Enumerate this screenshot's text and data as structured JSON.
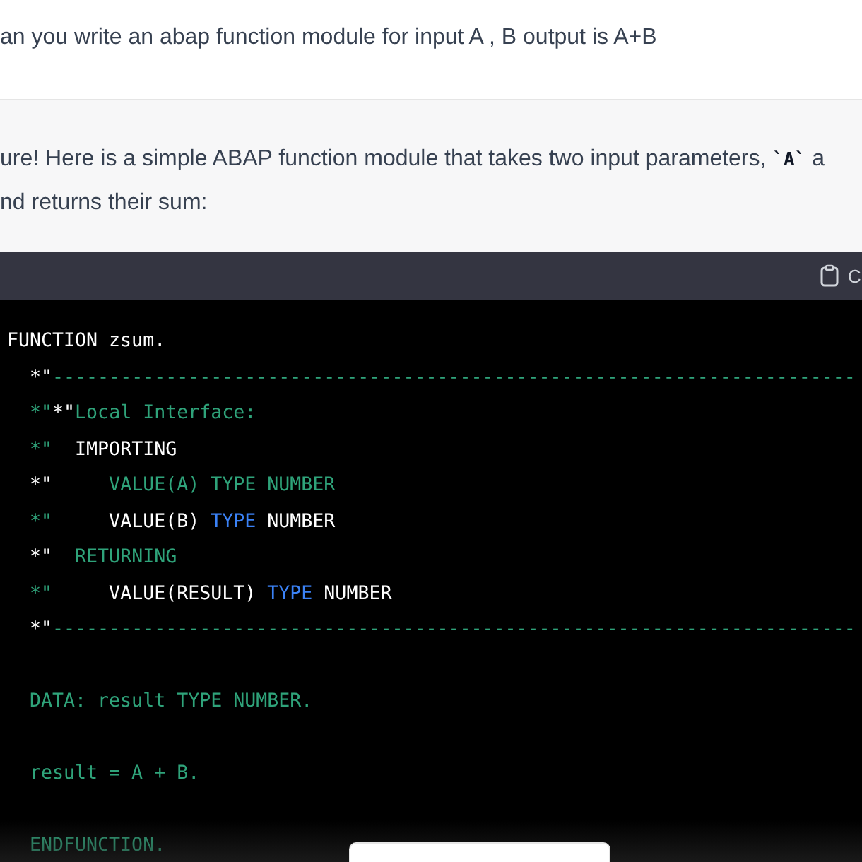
{
  "user_message": {
    "text": "an you write an abap function module for input A , B output is A+B"
  },
  "assistant_message": {
    "lines": [
      "ure! Here is a simple ABAP function module that takes two input parameters, **`A`** a",
      "nd returns their sum:"
    ]
  },
  "code_block": {
    "header_label": "C",
    "blocks": [
      [
        [
          {
            "kind": "text",
            "text": "FUNCTION zsum."
          }
        ],
        [
          {
            "kind": "text",
            "text": "  *\""
          },
          {
            "kind": "comment",
            "text": "-----------------------------------------------------------------------"
          }
        ],
        [
          {
            "kind": "comment",
            "text": "  *\""
          },
          {
            "kind": "text",
            "text": "*\""
          },
          {
            "kind": "comment",
            "text": "Local Interface:"
          }
        ],
        [
          {
            "kind": "comment",
            "text": "  *\""
          },
          {
            "kind": "text",
            "text": "  IMPORTING"
          }
        ],
        [
          {
            "kind": "text",
            "text": "  *\""
          },
          {
            "kind": "comment",
            "text": "     VALUE(A) TYPE NUMBER"
          }
        ],
        [
          {
            "kind": "comment",
            "text": "  *\""
          },
          {
            "kind": "text",
            "text": "     VALUE(B) "
          },
          {
            "kind": "keyword",
            "text": "TYPE"
          },
          {
            "kind": "text",
            "text": " NUMBER"
          }
        ],
        [
          {
            "kind": "text",
            "text": "  *\""
          },
          {
            "kind": "comment",
            "text": "  RETURNING"
          }
        ],
        [
          {
            "kind": "comment",
            "text": "  *\""
          },
          {
            "kind": "text",
            "text": "     VALUE(RESULT) "
          },
          {
            "kind": "keyword",
            "text": "TYPE"
          },
          {
            "kind": "text",
            "text": " NUMBER"
          }
        ],
        [
          {
            "kind": "text",
            "text": "  *\""
          },
          {
            "kind": "comment",
            "text": "-----------------------------------------------------------------------"
          }
        ]
      ],
      [
        [
          {
            "kind": "comment",
            "text": "  DATA: result TYPE NUMBER."
          }
        ]
      ],
      [
        [
          {
            "kind": "comment",
            "text": "  result = A + B."
          }
        ]
      ],
      [
        [
          {
            "kind": "comment",
            "text": "  ENDFUNCTION."
          }
        ]
      ]
    ]
  }
}
